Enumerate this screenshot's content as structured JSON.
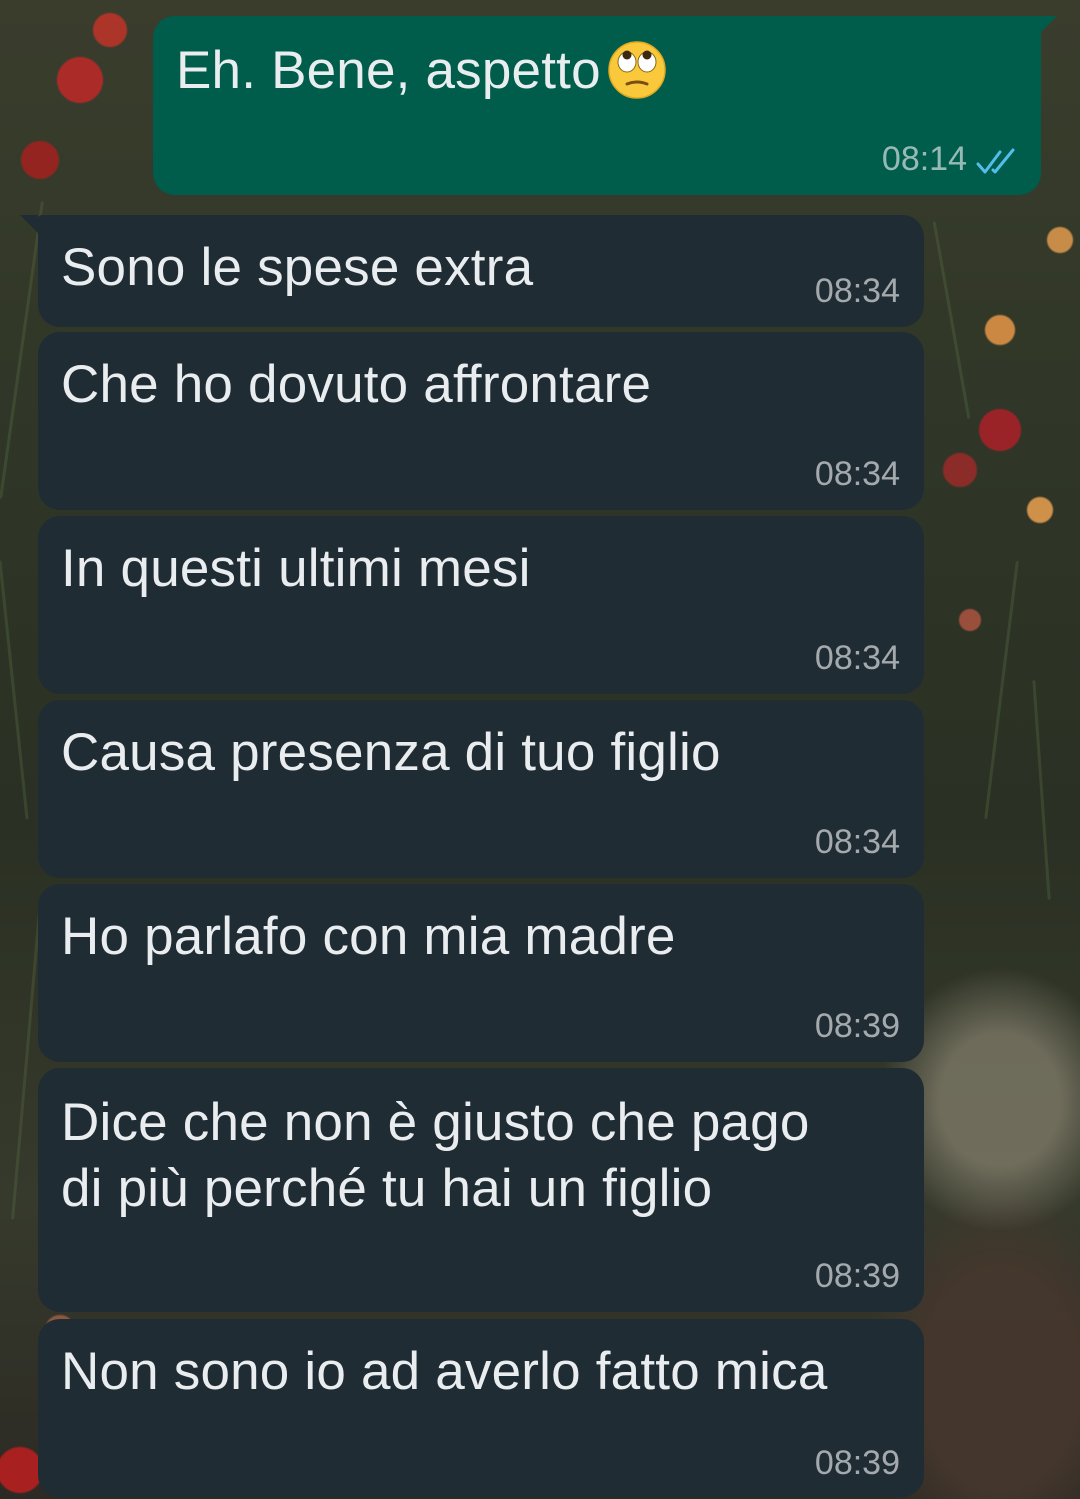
{
  "colors": {
    "outgoing_bubble": "#005c4b",
    "incoming_bubble": "#202c33",
    "text": "#e9edef",
    "read_ticks": "#53bdeb"
  },
  "messages": [
    {
      "direction": "outgoing",
      "text": "Eh. Bene, aspetto",
      "emoji": "face-with-rolling-eyes",
      "time": "08:14",
      "status": "read"
    },
    {
      "direction": "incoming",
      "text": "Sono le spese extra",
      "time": "08:34"
    },
    {
      "direction": "incoming",
      "text": "Che ho dovuto affrontare",
      "time": "08:34"
    },
    {
      "direction": "incoming",
      "text": "In questi ultimi mesi",
      "time": "08:34"
    },
    {
      "direction": "incoming",
      "text": "Causa presenza di tuo figlio",
      "time": "08:34"
    },
    {
      "direction": "incoming",
      "text": "Ho parlafo con mia madre",
      "time": "08:39"
    },
    {
      "direction": "incoming",
      "text": "Dice che non è giusto che pago\ndi più perché tu hai un figlio",
      "time": "08:39"
    },
    {
      "direction": "incoming",
      "text": "Non sono io ad averlo fatto mica",
      "time": "08:39"
    }
  ]
}
